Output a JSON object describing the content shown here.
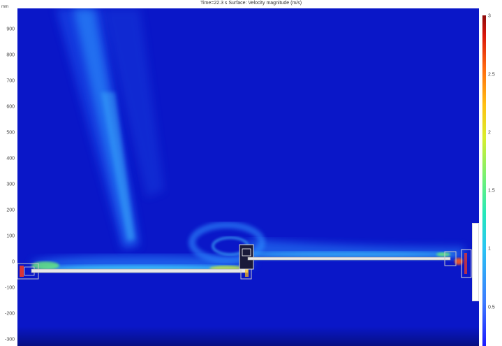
{
  "header": {
    "title": "Time=22.3 s   Surface: Velocity magnitude (m/s)",
    "unit_label": "mm"
  },
  "y_axis": {
    "ticks": [
      "900",
      "800",
      "700",
      "600",
      "500",
      "400",
      "300",
      "200",
      "100",
      "0",
      "-100",
      "-200",
      "-300"
    ]
  },
  "colorbar": {
    "ticks": [
      "3",
      "2.5",
      "2",
      "1.5",
      "1",
      "0.5"
    ]
  },
  "colors": {
    "background": "#0a17c8",
    "jet_core": "#2fa8ff",
    "hot": "#ff3a1a"
  }
}
